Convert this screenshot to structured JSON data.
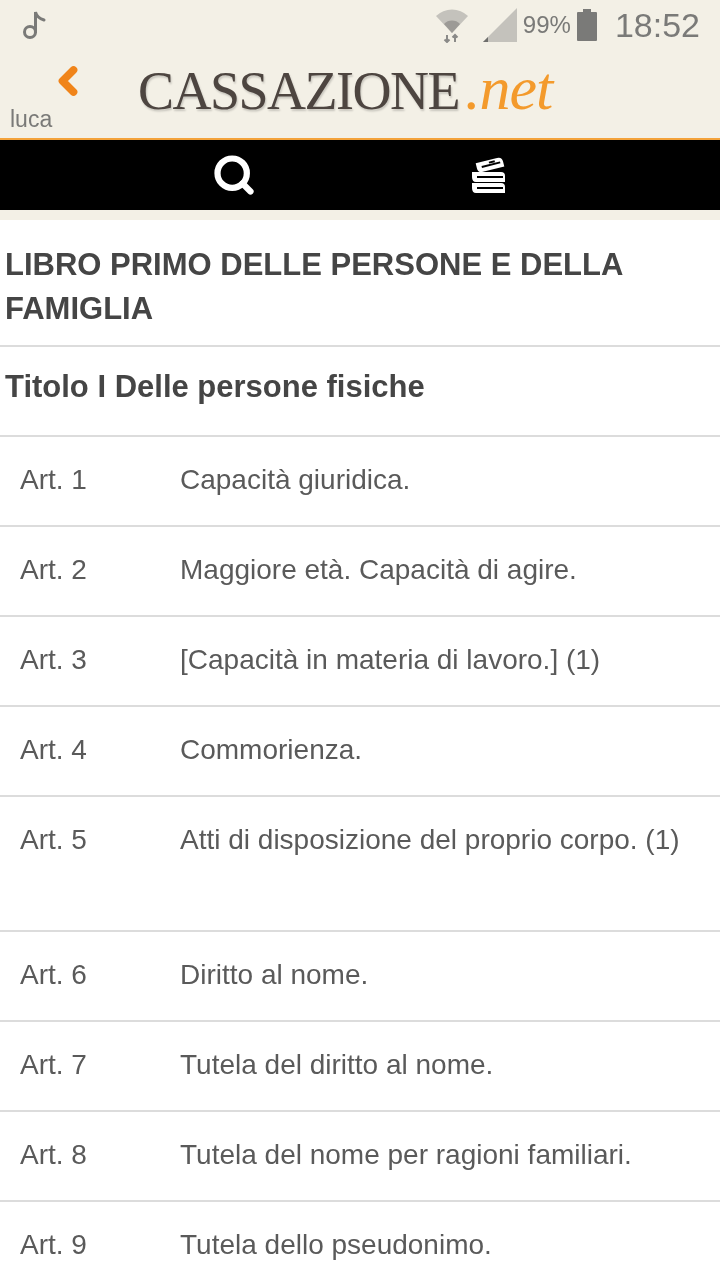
{
  "status_bar": {
    "battery": "99%",
    "time": "18:52"
  },
  "header": {
    "back_label": "luca",
    "logo": {
      "name": "CASSAZIONE",
      "suffix": ".net"
    }
  },
  "book": {
    "title": "LIBRO PRIMO DELLE PERSONE E DELLA FAMIGLIA"
  },
  "section": {
    "title": "Titolo I Delle persone fisiche"
  },
  "articles": [
    {
      "number": "Art. 1",
      "title": "Capacità giuridica.",
      "extra_space": false
    },
    {
      "number": "Art. 2",
      "title": "Maggiore età. Capacità di agire.",
      "extra_space": false
    },
    {
      "number": "Art. 3",
      "title": "[Capacità in materia di lavoro.] (1)",
      "extra_space": false
    },
    {
      "number": "Art. 4",
      "title": "Commorienza.",
      "extra_space": false
    },
    {
      "number": "Art. 5",
      "title": "Atti di disposizione del proprio corpo. (1)",
      "extra_space": true
    },
    {
      "number": "Art. 6",
      "title": "Diritto al nome.",
      "extra_space": false
    },
    {
      "number": "Art. 7",
      "title": "Tutela del diritto al nome.",
      "extra_space": false
    },
    {
      "number": "Art. 8",
      "title": "Tutela del nome per ragioni familiari.",
      "extra_space": false
    },
    {
      "number": "Art. 9",
      "title": "Tutela dello pseudonimo.",
      "extra_space": false
    }
  ]
}
